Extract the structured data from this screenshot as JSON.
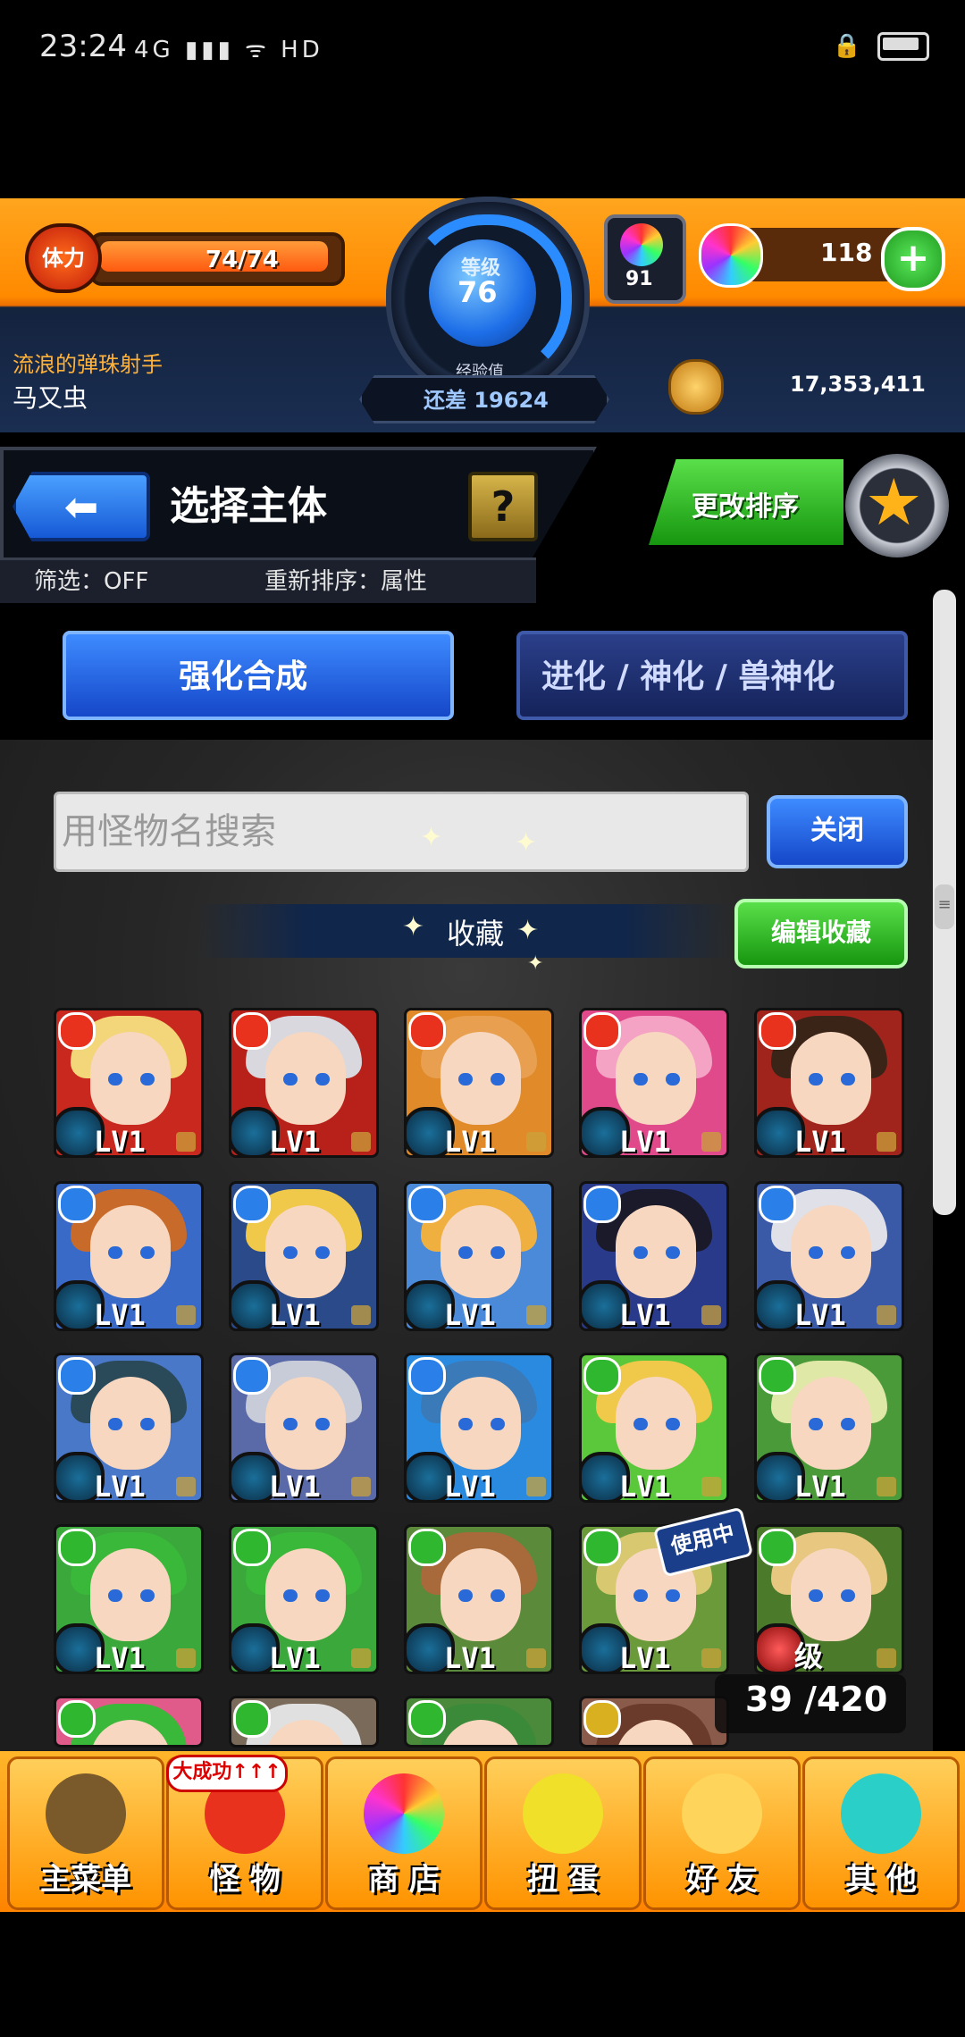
{
  "status_bar": {
    "time": "23:24",
    "icons": "4G ▮▮▮ ᯤ HD",
    "right": "🔒"
  },
  "hud": {
    "stamina_label": "体力",
    "stamina": "74/74",
    "level_caption": "等级",
    "level": "76",
    "exp_caption": "经验值",
    "exp_remaining": "还差 19624",
    "gem_count": "91",
    "orb_count": "118",
    "player_title": "流浪的弹珠射手",
    "player_name": "马又虫",
    "coins": "17,353,411"
  },
  "header": {
    "back_icon": "back-arrow-icon",
    "title": "选择主体",
    "help_label": "?",
    "filter": "筛选：OFF",
    "sort": "重新排序：属性",
    "sort_button": "更改排序",
    "star_icon": "star-icon"
  },
  "tabs": {
    "enhance": "强化合成",
    "evolve": "进化 / 神化 / 兽神化"
  },
  "search": {
    "placeholder": "用怪物名搜索",
    "close": "关闭"
  },
  "favorites": {
    "label": "收藏",
    "edit": "编辑收藏"
  },
  "cards": [
    {
      "lv": "LV1",
      "attr": "#e8321e",
      "bg": "#c8281e",
      "hair": "#f3d57a"
    },
    {
      "lv": "LV1",
      "attr": "#e8321e",
      "bg": "#b8201a",
      "hair": "#d8d8de"
    },
    {
      "lv": "LV1",
      "attr": "#e8321e",
      "bg": "#e08a2a",
      "hair": "#e8a050"
    },
    {
      "lv": "LV1",
      "attr": "#e8321e",
      "bg": "#e04a8a",
      "hair": "#f4a3c4"
    },
    {
      "lv": "LV1",
      "attr": "#e8321e",
      "bg": "#a0241c",
      "hair": "#3a2418"
    },
    {
      "lv": "LV1",
      "attr": "#2b7fe8",
      "bg": "#3a6ac8",
      "hair": "#c86a2a"
    },
    {
      "lv": "LV1",
      "attr": "#2b7fe8",
      "bg": "#2a4a8a",
      "hair": "#f0c84a"
    },
    {
      "lv": "LV1",
      "attr": "#2b7fe8",
      "bg": "#4a8ad8",
      "hair": "#f0b040"
    },
    {
      "lv": "LV1",
      "attr": "#2b7fe8",
      "bg": "#2a3a8a",
      "hair": "#1a1a2a"
    },
    {
      "lv": "LV1",
      "attr": "#2b7fe8",
      "bg": "#3a5aa8",
      "hair": "#e0e0e8"
    },
    {
      "lv": "LV1",
      "attr": "#2b7fe8",
      "bg": "#4a78c8",
      "hair": "#2a4a5a"
    },
    {
      "lv": "LV1",
      "attr": "#2b7fe8",
      "bg": "#5a6aa8",
      "hair": "#c8ccd8"
    },
    {
      "lv": "LV1",
      "attr": "#2b7fe8",
      "bg": "#2a8ae0",
      "hair": "#3a7ab8"
    },
    {
      "lv": "LV1",
      "attr": "#2fb82f",
      "bg": "#5ac83a",
      "hair": "#f0c84a"
    },
    {
      "lv": "LV1",
      "attr": "#2fb82f",
      "bg": "#4a9a3a",
      "hair": "#e0e8a8"
    },
    {
      "lv": "LV1",
      "attr": "#2fb82f",
      "bg": "#3aa83a",
      "hair": "#3ab83a"
    },
    {
      "lv": "LV1",
      "attr": "#2fb82f",
      "bg": "#3aa83a",
      "hair": "#3ab83a"
    },
    {
      "lv": "LV1",
      "attr": "#2fb82f",
      "bg": "#5a8a3a",
      "hair": "#a86a3a"
    },
    {
      "lv": "LV1",
      "attr": "#2fb82f",
      "bg": "#6a9a3a",
      "hair": "#d8c870"
    },
    {
      "lv": "",
      "attr": "#2fb82f",
      "bg": "#4a7a2a",
      "hair": "#e8c880"
    },
    {
      "lv": "",
      "attr": "#2fb82f",
      "bg": "#e05a8a",
      "hair": "#3ab83a"
    },
    {
      "lv": "",
      "attr": "#2fb82f",
      "bg": "#7a6a5a",
      "hair": "#e0e0e0"
    },
    {
      "lv": "",
      "attr": "#2fb82f",
      "bg": "#4a8a3a",
      "hair": "#3a8a3a"
    },
    {
      "lv": "",
      "attr": "#d8b020",
      "bg": "#8a5a4a",
      "hair": "#6a3a2a"
    }
  ],
  "in_use_badge": "使用中",
  "card_last_label": "级",
  "count": "39 /420",
  "bottom_nav": {
    "badge": "大成功↑↑↑",
    "items": [
      "主菜单",
      "怪 物",
      "商 店",
      "扭 蛋",
      "好 友",
      "其 他"
    ]
  }
}
